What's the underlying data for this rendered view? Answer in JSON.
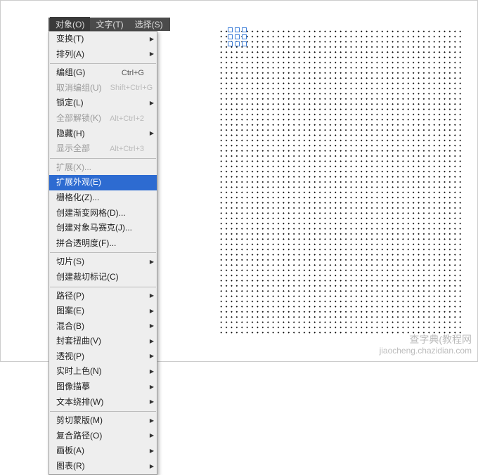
{
  "menubar": {
    "object": "对象(O)",
    "text": "文字(T)",
    "select": "选择(S)"
  },
  "menu": {
    "transform": "变换(T)",
    "arrange": "排列(A)",
    "group": "编组(G)",
    "group_sc": "Ctrl+G",
    "ungroup": "取消编组(U)",
    "ungroup_sc": "Shift+Ctrl+G",
    "lock": "锁定(L)",
    "unlockAll": "全部解锁(K)",
    "unlockAll_sc": "Alt+Ctrl+2",
    "hide": "隐藏(H)",
    "showAll": "显示全部",
    "showAll_sc": "Alt+Ctrl+3",
    "expand": "扩展(X)...",
    "expandAppearance": "扩展外观(E)",
    "rasterize": "栅格化(Z)...",
    "gradientMesh": "创建渐变网格(D)...",
    "objectMosaic": "创建对象马赛克(J)...",
    "flattenTrans": "拼合透明度(F)...",
    "slice": "切片(S)",
    "cropMarks": "创建裁切标记(C)",
    "path": "路径(P)",
    "pattern": "图案(E)",
    "blend": "混合(B)",
    "envelope": "封套扭曲(V)",
    "perspective": "透视(P)",
    "livePaint": "实时上色(N)",
    "imageTrace": "图像描摹",
    "textWrap": "文本绕排(W)",
    "clippingMask": "剪切蒙版(M)",
    "compoundPath": "复合路径(O)",
    "artboards": "画板(A)",
    "graph": "图表(R)"
  },
  "watermark": {
    "main": "查字典(教程网",
    "sub": "jiaocheng.chazidian.com"
  }
}
